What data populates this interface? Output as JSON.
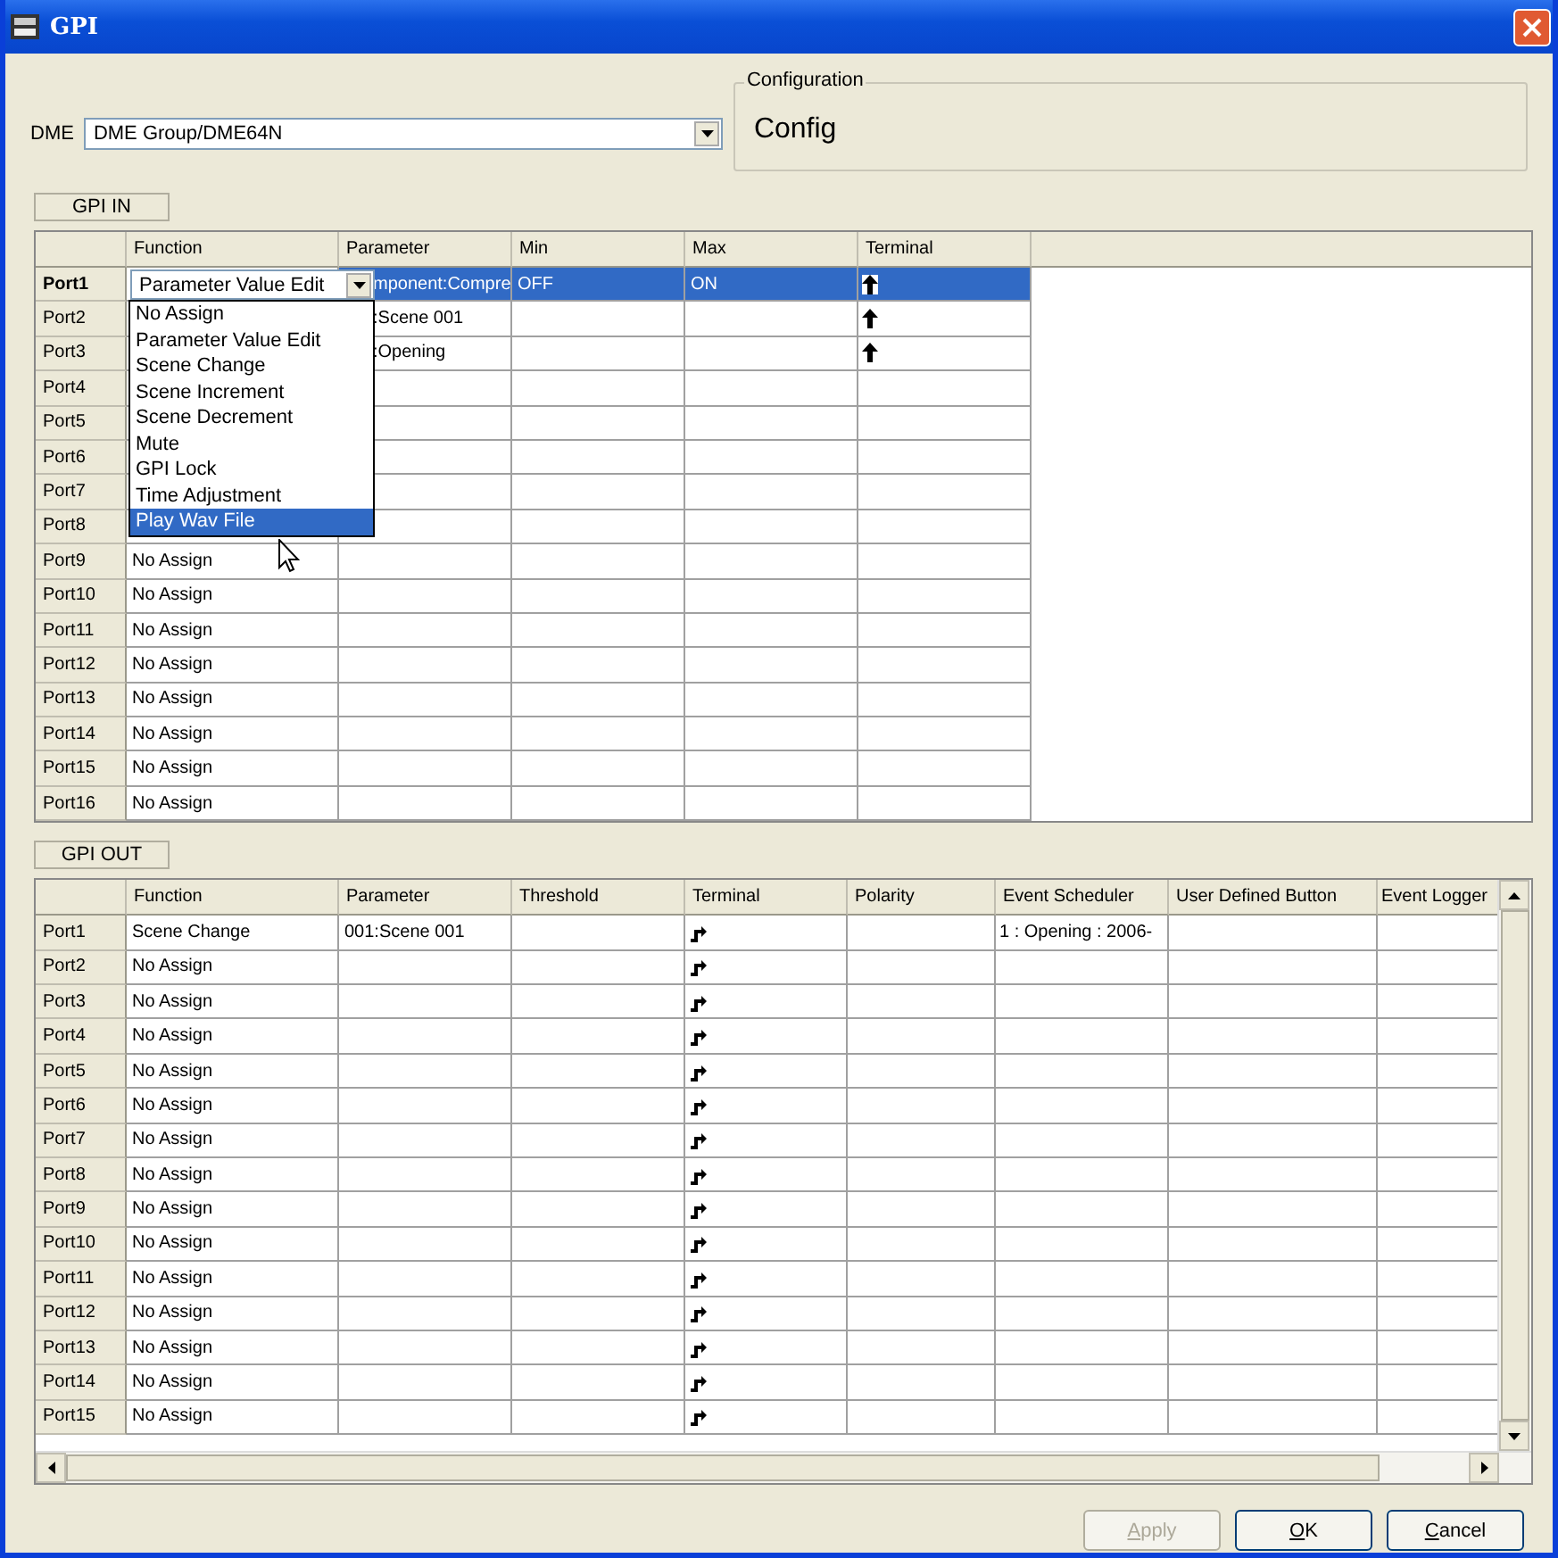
{
  "window": {
    "title": "GPI"
  },
  "dme": {
    "label": "DME",
    "value": "DME Group/DME64N"
  },
  "configuration": {
    "label": "Configuration",
    "value": "Config"
  },
  "gpi_in": {
    "label": "GPI IN",
    "columns": [
      "Function",
      "Parameter",
      "Min",
      "Max",
      "Terminal"
    ],
    "rows": [
      {
        "port": "Port1",
        "selected": true,
        "function": "Parameter Value Edit",
        "parameter": "mponent:Compre",
        "min": "OFF",
        "max": "ON",
        "terminal_icon": true
      },
      {
        "port": "Port2",
        "selected": false,
        "parameter": ":Scene 001",
        "terminal_icon": true
      },
      {
        "port": "Port3",
        "selected": false,
        "parameter": ":Opening",
        "terminal_icon": true
      },
      {
        "port": "Port4",
        "selected": false,
        "terminal_icon": false
      },
      {
        "port": "Port5",
        "selected": false,
        "terminal_icon": false
      },
      {
        "port": "Port6",
        "selected": false,
        "terminal_icon": false
      },
      {
        "port": "Port7",
        "selected": false,
        "terminal_icon": false
      },
      {
        "port": "Port8",
        "selected": false,
        "terminal_icon": false
      },
      {
        "port": "Port9",
        "selected": false,
        "function": "No Assign",
        "terminal_icon": false
      },
      {
        "port": "Port10",
        "selected": false,
        "function": "No Assign",
        "terminal_icon": false
      },
      {
        "port": "Port11",
        "selected": false,
        "function": "No Assign",
        "terminal_icon": false
      },
      {
        "port": "Port12",
        "selected": false,
        "function": "No Assign",
        "terminal_icon": false
      },
      {
        "port": "Port13",
        "selected": false,
        "function": "No Assign",
        "terminal_icon": false
      },
      {
        "port": "Port14",
        "selected": false,
        "function": "No Assign",
        "terminal_icon": false
      },
      {
        "port": "Port15",
        "selected": false,
        "function": "No Assign",
        "terminal_icon": false
      },
      {
        "port": "Port16",
        "selected": false,
        "function": "No Assign",
        "terminal_icon": false
      }
    ],
    "dropdown": {
      "items": [
        {
          "label": "No Assign",
          "selected": false
        },
        {
          "label": "Parameter Value Edit",
          "selected": false
        },
        {
          "label": "Scene Change",
          "selected": false
        },
        {
          "label": "Scene Increment",
          "selected": false
        },
        {
          "label": "Scene Decrement",
          "selected": false
        },
        {
          "label": "Mute",
          "selected": false
        },
        {
          "label": "GPI Lock",
          "selected": false
        },
        {
          "label": "Time Adjustment",
          "selected": false
        },
        {
          "label": "Play Wav File",
          "selected": true
        }
      ]
    }
  },
  "gpi_out": {
    "label": "GPI OUT",
    "columns": [
      "Function",
      "Parameter",
      "Threshold",
      "Terminal",
      "Polarity",
      "Event Scheduler",
      "User Defined Button",
      "Event Logger"
    ],
    "rows": [
      {
        "port": "Port1",
        "function": "Scene Change",
        "parameter": "001:Scene 001",
        "terminal_icon": true,
        "event_scheduler": "1 : Opening : 2006-"
      },
      {
        "port": "Port2",
        "function": "No Assign",
        "terminal_icon": true
      },
      {
        "port": "Port3",
        "function": "No Assign",
        "terminal_icon": true
      },
      {
        "port": "Port4",
        "function": "No Assign",
        "terminal_icon": true
      },
      {
        "port": "Port5",
        "function": "No Assign",
        "terminal_icon": true
      },
      {
        "port": "Port6",
        "function": "No Assign",
        "terminal_icon": true
      },
      {
        "port": "Port7",
        "function": "No Assign",
        "terminal_icon": true
      },
      {
        "port": "Port8",
        "function": "No Assign",
        "terminal_icon": true
      },
      {
        "port": "Port9",
        "function": "No Assign",
        "terminal_icon": true
      },
      {
        "port": "Port10",
        "function": "No Assign",
        "terminal_icon": true
      },
      {
        "port": "Port11",
        "function": "No Assign",
        "terminal_icon": true
      },
      {
        "port": "Port12",
        "function": "No Assign",
        "terminal_icon": true
      },
      {
        "port": "Port13",
        "function": "No Assign",
        "terminal_icon": true
      },
      {
        "port": "Port14",
        "function": "No Assign",
        "terminal_icon": true
      },
      {
        "port": "Port15",
        "function": "No Assign",
        "terminal_icon": true
      }
    ]
  },
  "buttons": [
    {
      "label": "Apply",
      "disabled": true
    },
    {
      "label": "OK",
      "disabled": false
    },
    {
      "label": "Cancel",
      "disabled": false
    }
  ]
}
